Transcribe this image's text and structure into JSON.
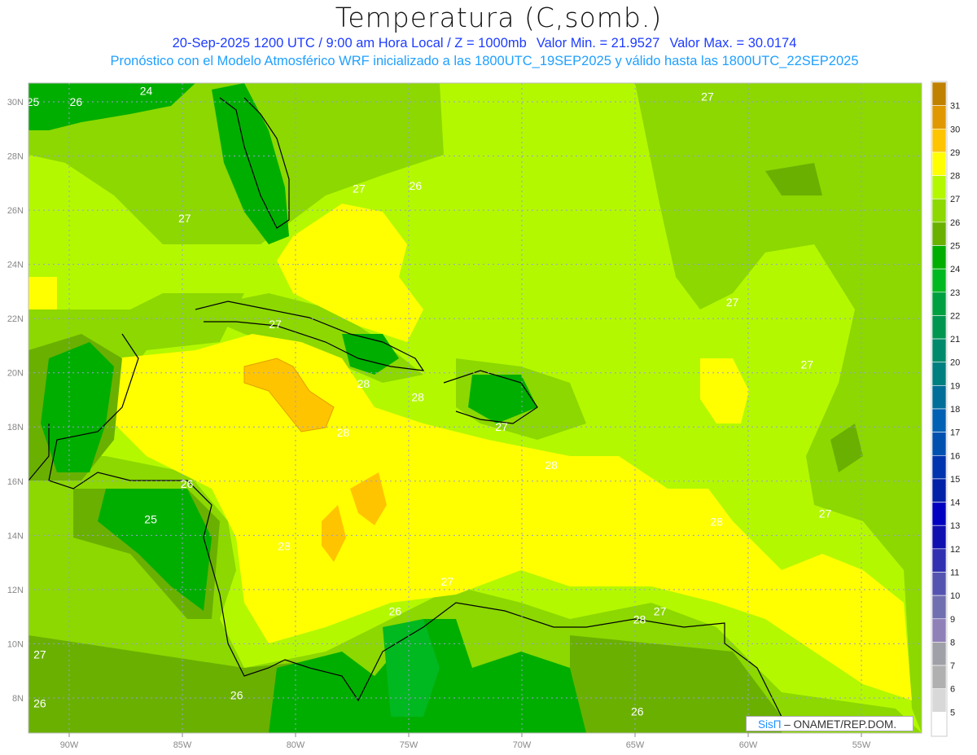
{
  "header": {
    "title": "Temperatura (C,somb.)",
    "date_time": "20-Sep-2025  1200 UTC / 9:00 am Hora Local / Z = 1000mb",
    "min_value": "Valor Min. = 21.9527",
    "max_value": "Valor Max. = 30.0174",
    "forecast_info": "Pronóstico con el Modelo Atmosférico WRF inicializado a las 1800UTC_19SEP2025 y válido hasta las  1800UTC_22SEP2025"
  },
  "axes": {
    "lon_labels": [
      "90W",
      "85W",
      "80W",
      "75W",
      "70W",
      "65W",
      "60W",
      "55W"
    ],
    "lon_values": [
      -90,
      -85,
      -80,
      -75,
      -70,
      -65,
      -60,
      -55
    ],
    "lat_labels": [
      "30N",
      "28N",
      "26N",
      "24N",
      "22N",
      "20N",
      "18N",
      "16N",
      "14N",
      "12N",
      "10N",
      "8N"
    ],
    "lat_values": [
      30,
      28,
      26,
      24,
      22,
      20,
      18,
      16,
      14,
      12,
      10,
      8
    ]
  },
  "colorbar": {
    "labels": [
      "31",
      "30",
      "29",
      "28",
      "27",
      "26",
      "25",
      "24",
      "23",
      "22",
      "21",
      "20",
      "19",
      "18",
      "17",
      "16",
      "15",
      "14",
      "13",
      "12",
      "11",
      "10",
      "9",
      "8",
      "7",
      "6",
      "5"
    ],
    "colors": [
      "#c08000",
      "#e09800",
      "#ffc400",
      "#ffff00",
      "#b4f800",
      "#8cd800",
      "#6ab000",
      "#00ae00",
      "#00b820",
      "#00a040",
      "#009650",
      "#008a6c",
      "#007f80",
      "#006e98",
      "#0060b4",
      "#0050b0",
      "#0034ae",
      "#0020a8",
      "#0000c0",
      "#1010b0",
      "#3030b0",
      "#5454b0",
      "#7070b0",
      "#9080b8",
      "#a0a0a8",
      "#b0b0b0",
      "#d8d8d8",
      "#ffffff"
    ]
  },
  "contour_labels": [
    {
      "text": "25",
      "lon": -91.6,
      "lat": 30.0
    },
    {
      "text": "26",
      "lon": -89.7,
      "lat": 30.0
    },
    {
      "text": "24",
      "lon": -86.6,
      "lat": 30.4
    },
    {
      "text": "27",
      "lon": -84.9,
      "lat": 25.7
    },
    {
      "text": "27",
      "lon": -77.2,
      "lat": 26.8
    },
    {
      "text": "26",
      "lon": -74.7,
      "lat": 26.9
    },
    {
      "text": "27",
      "lon": -61.8,
      "lat": 30.2
    },
    {
      "text": "27",
      "lon": -80.9,
      "lat": 21.8
    },
    {
      "text": "27",
      "lon": -60.7,
      "lat": 22.6
    },
    {
      "text": "27",
      "lon": -57.4,
      "lat": 20.3
    },
    {
      "text": "28",
      "lon": -77.0,
      "lat": 19.6
    },
    {
      "text": "28",
      "lon": -74.6,
      "lat": 19.1
    },
    {
      "text": "28",
      "lon": -77.9,
      "lat": 17.8
    },
    {
      "text": "27",
      "lon": -70.9,
      "lat": 18.0
    },
    {
      "text": "28",
      "lon": -68.7,
      "lat": 16.6
    },
    {
      "text": "26",
      "lon": -84.8,
      "lat": 15.9
    },
    {
      "text": "25",
      "lon": -86.4,
      "lat": 14.6
    },
    {
      "text": "28",
      "lon": -80.5,
      "lat": 13.6
    },
    {
      "text": "28",
      "lon": -61.4,
      "lat": 14.5
    },
    {
      "text": "27",
      "lon": -56.6,
      "lat": 14.8
    },
    {
      "text": "27",
      "lon": -73.3,
      "lat": 12.3
    },
    {
      "text": "28",
      "lon": -64.8,
      "lat": 10.9
    },
    {
      "text": "27",
      "lon": -63.9,
      "lat": 11.2
    },
    {
      "text": "26",
      "lon": -75.6,
      "lat": 11.2
    },
    {
      "text": "27",
      "lon": -91.3,
      "lat": 9.6
    },
    {
      "text": "26",
      "lon": -91.3,
      "lat": 7.8
    },
    {
      "text": "26",
      "lon": -82.6,
      "lat": 8.1
    },
    {
      "text": "26",
      "lon": -64.9,
      "lat": 7.5
    }
  ],
  "credit": {
    "brand": "SisΠ",
    "text": " – ONAMET/REP.DOM."
  }
}
